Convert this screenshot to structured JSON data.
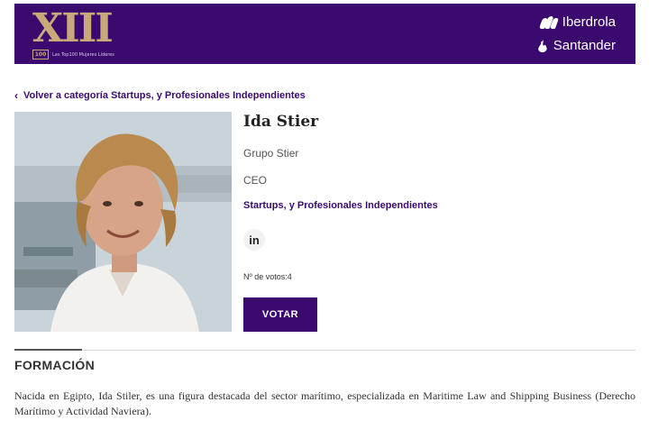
{
  "header": {
    "logo_title": "XIII",
    "logo_badge": "100",
    "logo_subtitle": "Las Top100 Mujeres Líderes",
    "sponsors": [
      {
        "name": "Iberdrola",
        "icon": "leaf-icon"
      },
      {
        "name": "Santander",
        "icon": "flame-icon"
      }
    ],
    "background_color": "#3a0a6e",
    "accent_color": "#c9a97a"
  },
  "back_link": {
    "label": "Volver a categoría Startups, y Profesionales Independientes"
  },
  "profile": {
    "name": "Ida Stier",
    "company": "Grupo Stier",
    "role": "CEO",
    "category": "Startups, y Profesionales Independientes",
    "social_icon": "linkedin-icon",
    "social_label": "in",
    "votes_label": "Nº de votos:4",
    "vote_button": "VOTAR"
  },
  "section": {
    "title": "FORMACIÓN",
    "text": "Nacida en Egipto, Ida Stiler, es una figura destacada del sector marítimo, especializada en Maritime Law and Shipping Business (Derecho Marítimo y Actividad Naviera)."
  }
}
